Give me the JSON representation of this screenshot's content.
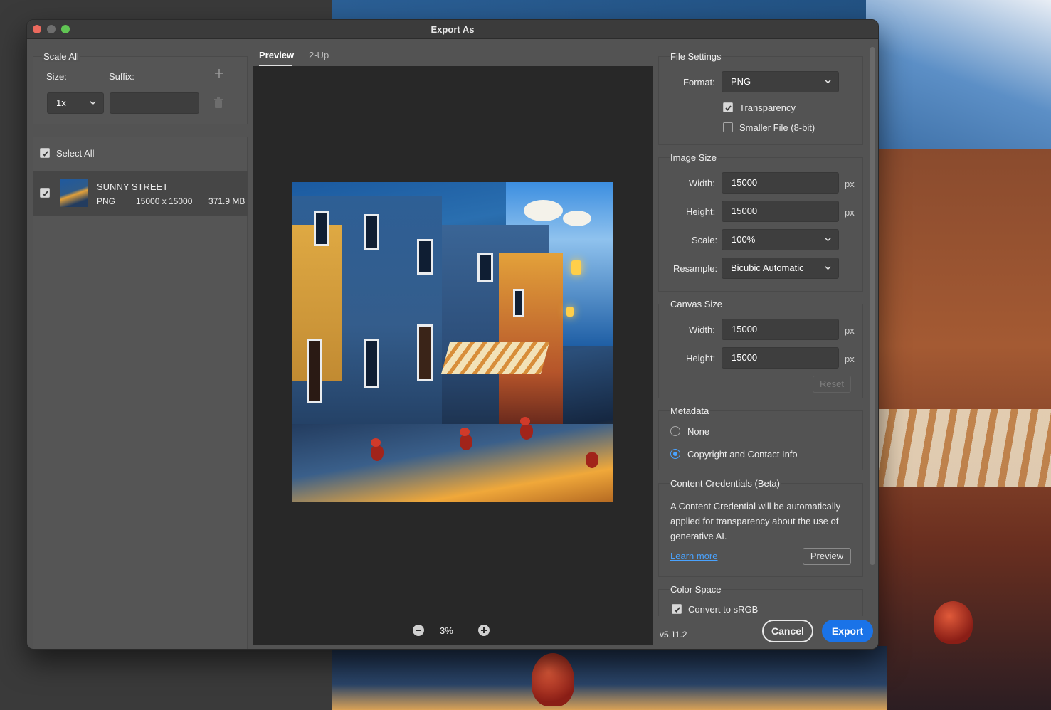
{
  "window": {
    "title": "Export As"
  },
  "left": {
    "scale_all_label": "Scale All",
    "size_label": "Size:",
    "suffix_label": "Suffix:",
    "size_value": "1x",
    "suffix_value": "",
    "select_all_label": "Select All",
    "asset": {
      "name": "SUNNY STREET",
      "format": "PNG",
      "dimensions": "15000 x 15000",
      "file_size": "371.9 MB"
    }
  },
  "preview": {
    "tabs": [
      {
        "label": "Preview",
        "active": true
      },
      {
        "label": "2-Up",
        "active": false
      }
    ],
    "zoom": "3%"
  },
  "file_settings": {
    "title": "File Settings",
    "format_label": "Format:",
    "format_value": "PNG",
    "transparency_label": "Transparency",
    "transparency_checked": true,
    "smaller_file_label": "Smaller File (8-bit)",
    "smaller_file_checked": false
  },
  "image_size": {
    "title": "Image Size",
    "width_label": "Width:",
    "width_value": "15000",
    "height_label": "Height:",
    "height_value": "15000",
    "unit": "px",
    "scale_label": "Scale:",
    "scale_value": "100%",
    "resample_label": "Resample:",
    "resample_value": "Bicubic Automatic"
  },
  "canvas_size": {
    "title": "Canvas Size",
    "width_label": "Width:",
    "width_value": "15000",
    "height_label": "Height:",
    "height_value": "15000",
    "unit": "px",
    "reset_label": "Reset"
  },
  "metadata": {
    "title": "Metadata",
    "options": [
      {
        "label": "None",
        "selected": false
      },
      {
        "label": "Copyright and Contact Info",
        "selected": true
      }
    ]
  },
  "content_credentials": {
    "title": "Content Credentials (Beta)",
    "description": "A Content Credential will be automatically applied for transparency about the use of generative AI.",
    "learn_more": "Learn more",
    "preview_button": "Preview"
  },
  "color_space": {
    "title": "Color Space",
    "convert_label": "Convert to sRGB",
    "convert_checked": true
  },
  "footer": {
    "version": "v5.11.2",
    "cancel": "Cancel",
    "export": "Export"
  },
  "colors": {
    "accent": "#1a73e8",
    "dialog_bg": "#535353",
    "field_bg": "#3e3e3e",
    "link": "#4aa3ff"
  }
}
